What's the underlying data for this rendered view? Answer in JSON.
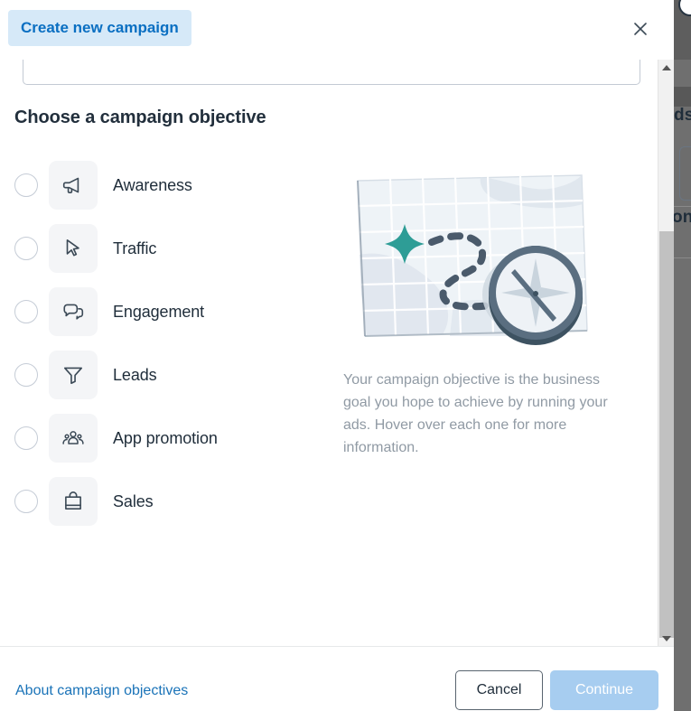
{
  "header": {
    "badge_label": "Create new campaign",
    "close_icon": "close-icon"
  },
  "body": {
    "campaign_name_value": "",
    "campaign_name_placeholder": "",
    "objective_heading": "Choose a campaign objective",
    "objectives": [
      {
        "label": "Awareness",
        "icon": "megaphone-icon",
        "selected": false
      },
      {
        "label": "Traffic",
        "icon": "cursor-icon",
        "selected": false
      },
      {
        "label": "Engagement",
        "icon": "chat-bubbles-icon",
        "selected": false
      },
      {
        "label": "Leads",
        "icon": "funnel-icon",
        "selected": false
      },
      {
        "label": "App promotion",
        "icon": "people-group-icon",
        "selected": false
      },
      {
        "label": "Sales",
        "icon": "shopping-bag-icon",
        "selected": false
      }
    ],
    "description": "Your campaign objective is the business goal you hope to achieve by running your ads. Hover over each one for more information.",
    "illustration": "map-with-compass-illustration"
  },
  "footer": {
    "about_link": "About campaign objectives",
    "cancel_label": "Cancel",
    "continue_label": "Continue"
  },
  "background": {
    "fragment_1": "ds",
    "fragment_2": "on"
  },
  "colors": {
    "badge_bg": "#d6e9f8",
    "badge_text": "#0a6fc2",
    "link": "#1a73b8",
    "continue_disabled_bg": "#a7cdf0",
    "illustration_accent": "#2e9d96",
    "icon_box_bg": "#f4f5f7",
    "text_primary": "#1f2d3a",
    "text_muted": "#909aa4"
  }
}
